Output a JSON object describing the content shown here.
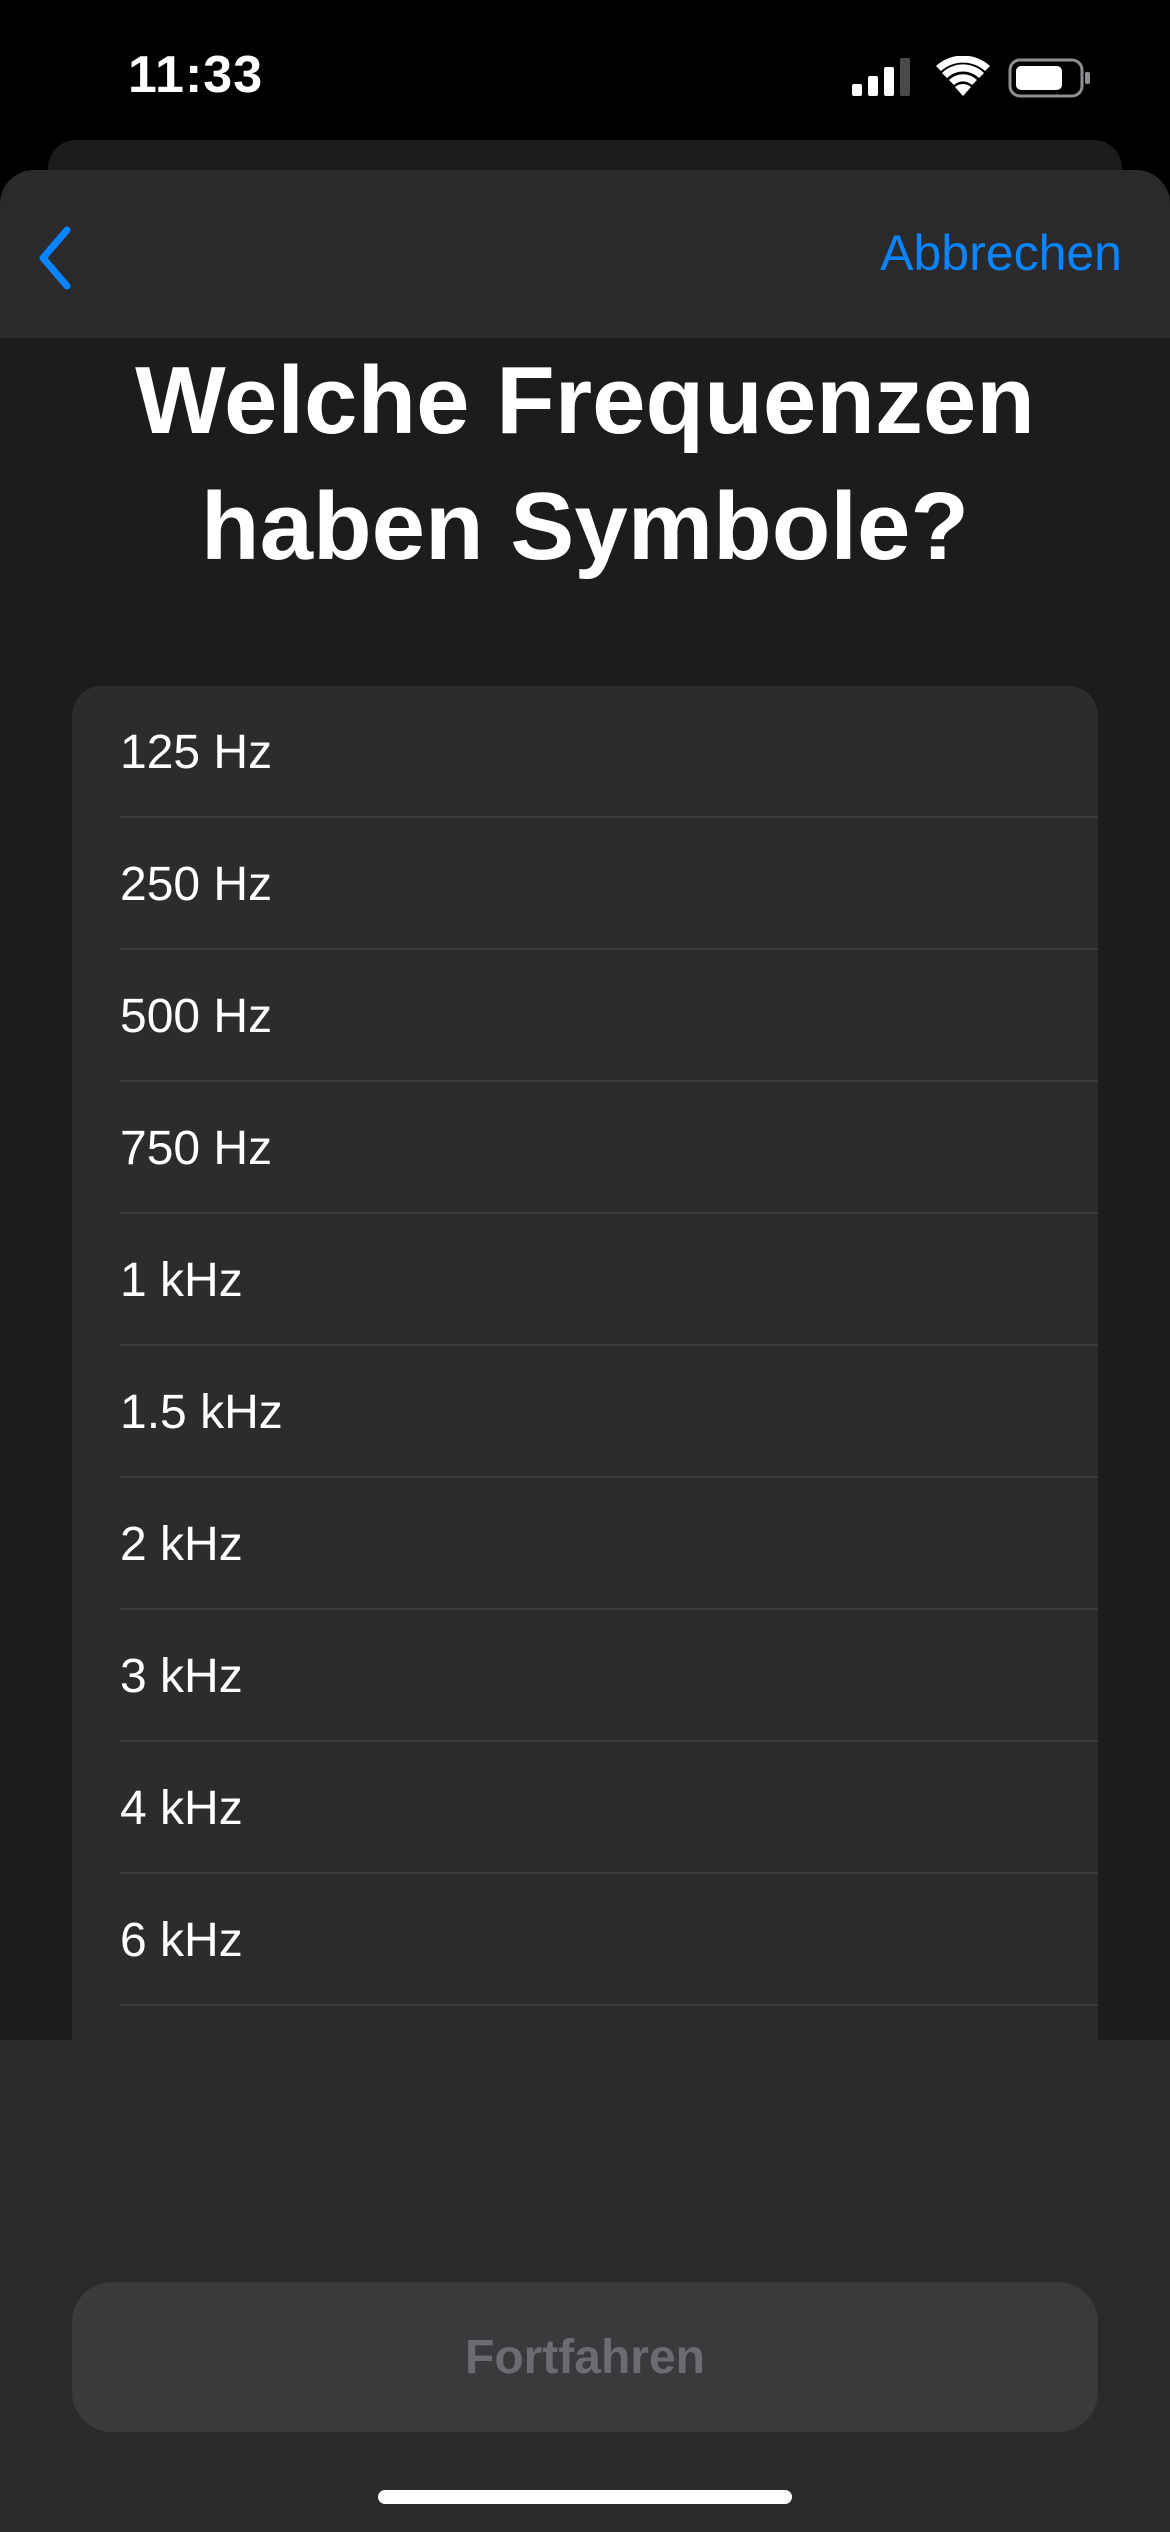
{
  "status_bar": {
    "time": "11:33",
    "icons": [
      "cellular-signal-icon",
      "wifi-icon",
      "battery-icon"
    ]
  },
  "nav": {
    "back_icon": "chevron-left-icon",
    "cancel_label": "Abbrechen"
  },
  "page": {
    "title": "Welche Frequenzen haben Symbole?"
  },
  "frequencies": [
    {
      "label": "125 Hz"
    },
    {
      "label": "250 Hz"
    },
    {
      "label": "500 Hz"
    },
    {
      "label": "750 Hz"
    },
    {
      "label": "1 kHz"
    },
    {
      "label": "1.5 kHz"
    },
    {
      "label": "2 kHz"
    },
    {
      "label": "3 kHz"
    },
    {
      "label": "4 kHz"
    },
    {
      "label": "6 kHz"
    }
  ],
  "footer": {
    "continue_label": "Fortfahren"
  },
  "colors": {
    "accent": "#0a84ff",
    "background": "#1c1c1e",
    "list_background": "#2c2c2e",
    "disabled_text": "#6b6b70"
  }
}
